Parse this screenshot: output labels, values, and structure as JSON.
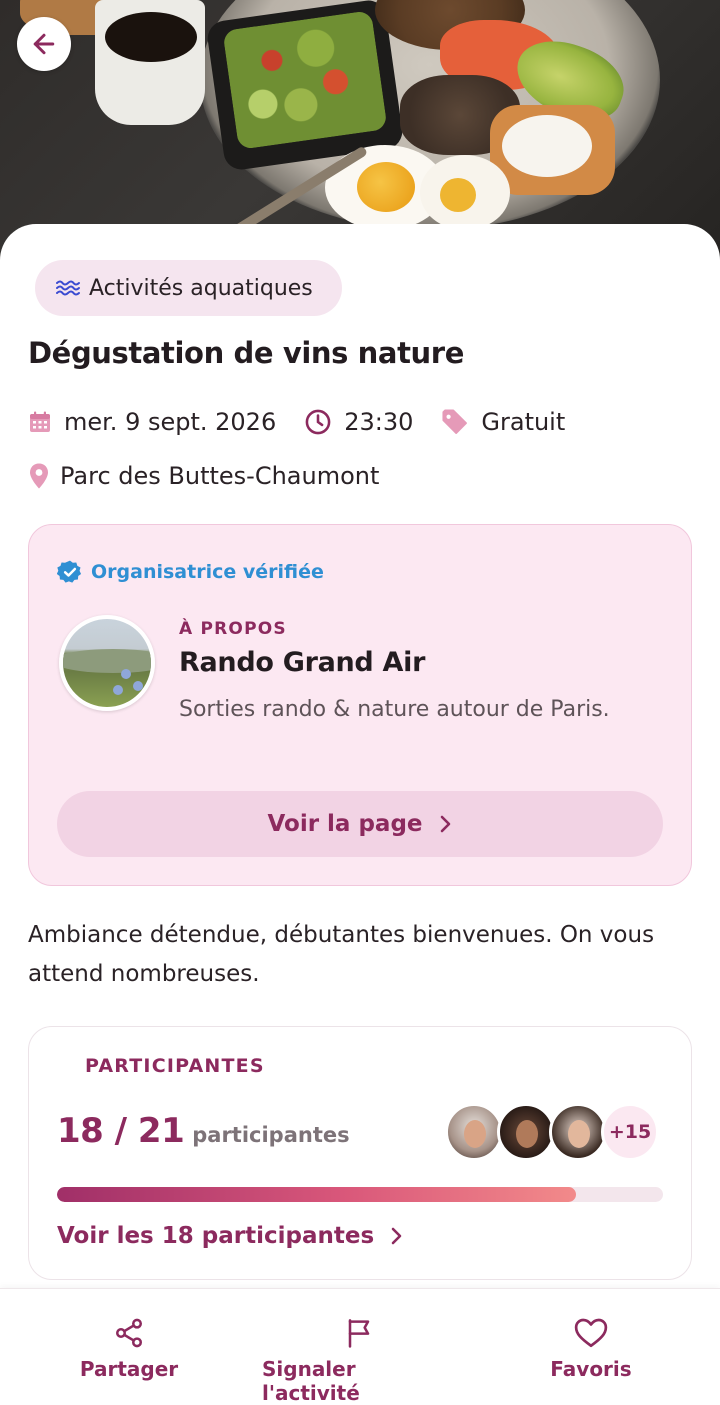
{
  "category": {
    "label": "Activités aquatiques",
    "icon": "waves-icon"
  },
  "event": {
    "title": "Dégustation de vins nature",
    "date": "mer. 9 sept. 2026",
    "time": "23:30",
    "price": "Gratuit",
    "location": "Parc des Buttes-Chaumont",
    "description": "Ambiance détendue, débutantes bienvenues. On vous attend nombreuses."
  },
  "organizer": {
    "verified_label": "Organisatrice vérifiée",
    "about_label": "À PROPOS",
    "name": "Rando Grand Air",
    "description": "Sorties rando & nature autour de Paris.",
    "see_page_label": "Voir la page"
  },
  "participants": {
    "section_label": "PARTICIPANTES",
    "count": "18 / 21",
    "unit": "participantes",
    "more_count": "+15",
    "fill_fraction": 0.857,
    "see_all_label": "Voir les 18 participantes"
  },
  "bottom_bar": {
    "share_label": "Partager",
    "report_label": "Signaler l'activité",
    "favorites_label": "Favoris"
  },
  "colors": {
    "accent": "#8c2a5e",
    "chip_bg": "#f5e5ef",
    "card_bg": "#fce8f2",
    "verified": "#2f8fd3",
    "icon_pink": "#e59ab8"
  }
}
